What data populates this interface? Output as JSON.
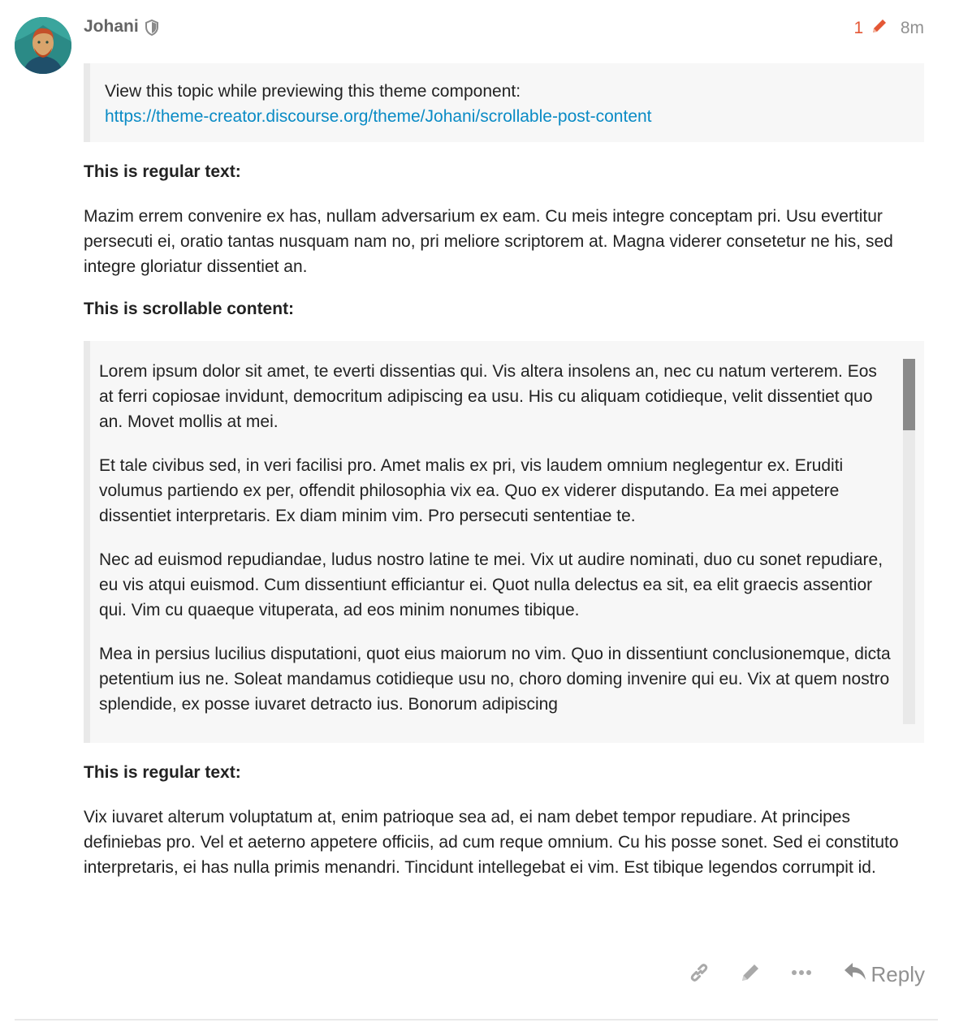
{
  "post": {
    "author": "Johani",
    "edit_count": "1",
    "age": "8m"
  },
  "quote": {
    "text": "View this topic while previewing this theme component:",
    "link": "https://theme-creator.discourse.org/theme/Johani/scrollable-post-content"
  },
  "sections": {
    "regular_heading_1": "This is regular text:",
    "regular_text_1": "Mazim errem convenire ex has, nullam adversarium ex eam. Cu meis integre conceptam pri. Usu evertitur persecuti ei, oratio tantas nusquam nam no, pri meliore scriptorem at. Magna viderer consetetur ne his, sed integre gloriatur dissentiet an.",
    "scrollable_heading": "This is scrollable content:",
    "scrollable_paragraphs": [
      "Lorem ipsum dolor sit amet, te everti dissentias qui. Vis altera insolens an, nec cu natum verterem. Eos at ferri copiosae invidunt, democritum adipiscing ea usu. His cu aliquam cotidieque, velit dissentiet quo an. Movet mollis at mei.",
      "Et tale civibus sed, in veri facilisi pro. Amet malis ex pri, vis laudem omnium neglegentur ex. Eruditi volumus partiendo ex per, offendit philosophia vix ea. Quo ex viderer disputando. Ea mei appetere dissentiet interpretaris. Ex diam minim vim. Pro persecuti sententiae te.",
      "Nec ad euismod repudiandae, ludus nostro latine te mei. Vix ut audire nominati, duo cu sonet repudiare, eu vis atqui euismod. Cum dissentiunt efficiantur ei. Quot nulla delectus ea sit, ea elit graecis assentior qui. Vim cu quaeque vituperata, ad eos minim nonumes tibique.",
      "Mea in persius lucilius disputationi, quot eius maiorum no vim. Quo in dissentiunt conclusionemque, dicta petentium ius ne. Soleat mandamus cotidieque usu no, choro doming invenire qui eu. Vix at quem nostro splendide, ex posse iuvaret detracto ius. Bonorum adipiscing"
    ],
    "regular_heading_2": "This is regular text:",
    "regular_text_2": "Vix iuvaret alterum voluptatum at, enim patrioque sea ad, ei nam debet tempor repudiare. At principes definiebas pro. Vel et aeterno appetere officiis, ad cum reque omnium. Cu his posse sonet. Sed ei constituto interpretaris, ei has nulla primis menandri. Tincidunt intellegebat ei vim. Est tibique legendos corrumpit id."
  },
  "actions": {
    "icons": [
      "link-icon",
      "pencil-icon",
      "ellipsis-icon",
      "reply-icon"
    ],
    "reply_label": "Reply"
  },
  "colors": {
    "accent": "#e45735",
    "link": "#0a8bc5",
    "muted": "#919191"
  }
}
